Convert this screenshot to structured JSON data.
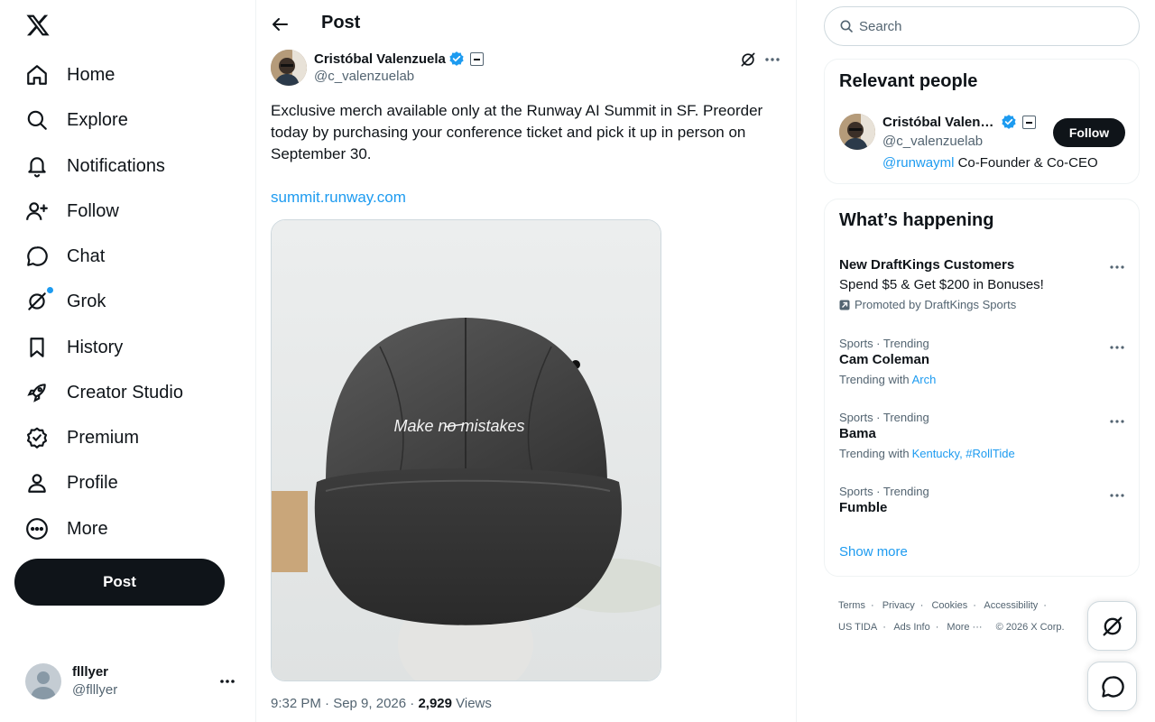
{
  "nav": {
    "items": [
      {
        "label": "Home",
        "icon": "home-icon"
      },
      {
        "label": "Explore",
        "icon": "search-icon"
      },
      {
        "label": "Notifications",
        "icon": "bell-icon"
      },
      {
        "label": "Follow",
        "icon": "person-add-icon"
      },
      {
        "label": "Chat",
        "icon": "chat-icon"
      },
      {
        "label": "Grok",
        "icon": "grok-icon"
      },
      {
        "label": "History",
        "icon": "bookmark-icon"
      },
      {
        "label": "Creator Studio",
        "icon": "rocket-icon"
      },
      {
        "label": "Premium",
        "icon": "verified-badge-icon"
      },
      {
        "label": "Profile",
        "icon": "person-icon"
      },
      {
        "label": "More",
        "icon": "more-circle-icon"
      }
    ],
    "post_label": "Post"
  },
  "account": {
    "name": "flllyer",
    "handle": "@flllyer"
  },
  "header": {
    "title": "Post"
  },
  "tweet": {
    "author_name": "Cristóbal Valenzuela",
    "author_handle": "@c_valenzuelab",
    "text": "Exclusive merch available only at the Runway AI Summit in SF. Preorder today by purchasing your conference ticket and pick it up in person on September 30.",
    "link": "summit.runway.com",
    "image_caption": "Make no mistakes",
    "time": "9:32 PM · Sep 9, 2026 · ",
    "views_count": "2,929",
    "views_label": " Views"
  },
  "search": {
    "placeholder": "Search"
  },
  "relevant": {
    "title": "Relevant people",
    "name": "Cristóbal Valenzuela",
    "handle": "@c_valenzuelab",
    "bio_mention": "@runwayml",
    "bio_text": " Co-Founder & Co-CEO",
    "follow_label": "Follow"
  },
  "happening": {
    "title": "What’s happening",
    "promo": {
      "title": "New DraftKings Customers",
      "subtitle": "Spend $5 & Get $200 in Bonuses!",
      "promoted": "Promoted by DraftKings Sports"
    },
    "trends": [
      {
        "category": "Sports · Trending",
        "title": "Cam Coleman",
        "with_label": "Trending with",
        "tags": "Arch"
      },
      {
        "category": "Sports · Trending",
        "title": "Bama",
        "with_label": "Trending with",
        "tags": "Kentucky, #RollTide"
      },
      {
        "category": "Sports · Trending",
        "title": "Fumble",
        "with_label": "",
        "tags": ""
      }
    ],
    "show_more": "Show more"
  },
  "footer": {
    "links": [
      "Terms",
      "Privacy",
      "Cookies",
      "Accessibility",
      "US TIDA",
      "Ads Info",
      "More ···",
      "© 2026 X Corp."
    ]
  },
  "colors": {
    "accent": "#1d9bf0",
    "text": "#0f1419",
    "secondary": "#536471",
    "border": "#eff3f4"
  }
}
